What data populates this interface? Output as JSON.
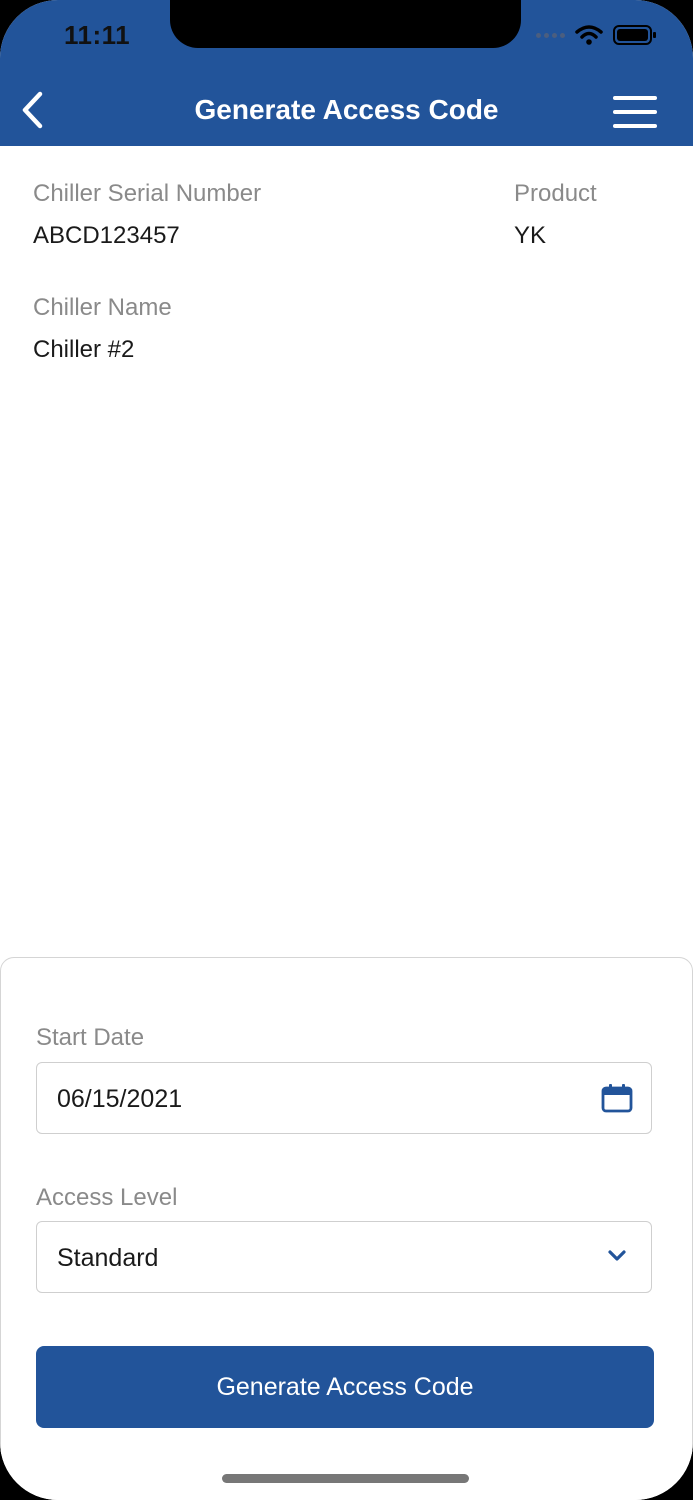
{
  "status": {
    "time": "11:11"
  },
  "header": {
    "title": "Generate Access Code"
  },
  "details": {
    "serial_label": "Chiller Serial Number",
    "serial_value": "ABCD123457",
    "product_label": "Product",
    "product_value": "YK",
    "name_label": "Chiller Name",
    "name_value": "Chiller #2"
  },
  "form": {
    "start_date_label": "Start Date",
    "start_date_value": "06/15/2021",
    "access_level_label": "Access Level",
    "access_level_value": "Standard",
    "submit_label": "Generate Access Code"
  },
  "colors": {
    "brand": "#22549a",
    "label": "#8a8a8a",
    "text": "#1a1a1a"
  },
  "icons": [
    "back-chevron-icon",
    "hamburger-menu-icon",
    "wifi-icon",
    "battery-icon",
    "calendar-icon",
    "chevron-down-icon"
  ]
}
